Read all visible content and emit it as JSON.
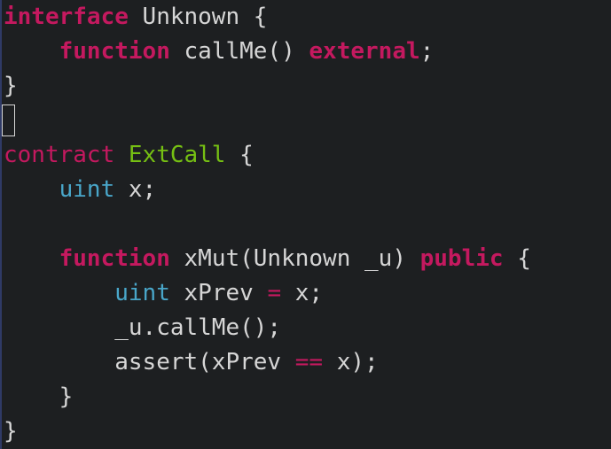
{
  "editor": {
    "lines": [
      {
        "kw": "interface",
        "rest": " Unknown {"
      },
      {
        "indent": "    ",
        "kw": "function",
        "mid": " callMe() ",
        "kw2": "external",
        "end": ";"
      },
      {
        "text": "}"
      },
      {
        "cursor": true
      },
      {
        "kw": "contract",
        "sp": " ",
        "name": "ExtCall",
        "rest": " {"
      },
      {
        "indent": "    ",
        "type": "uint",
        "rest": " x;"
      },
      {
        "text": ""
      },
      {
        "indent": "    ",
        "kw": "function",
        "mid": " xMut(Unknown _u) ",
        "kw2": "public",
        "end": " {"
      },
      {
        "indent": "        ",
        "type": "uint",
        "mid": " xPrev ",
        "op": "=",
        "end": " x;"
      },
      {
        "indent": "        ",
        "text": "_u.callMe();"
      },
      {
        "indent": "        ",
        "mid": "assert(xPrev ",
        "op": "==",
        "end": " x);"
      },
      {
        "indent": "    ",
        "text": "}"
      },
      {
        "text": "}"
      }
    ]
  }
}
